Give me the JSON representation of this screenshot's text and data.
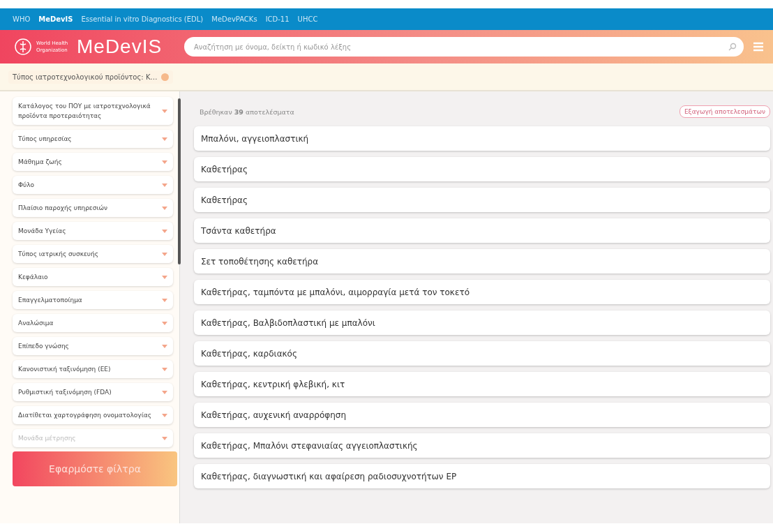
{
  "nav": [
    {
      "label": "WHO",
      "selected": false
    },
    {
      "label": "MeDevIS",
      "selected": true
    },
    {
      "label": "Essential in vitro Diagnostics (EDL)",
      "selected": false
    },
    {
      "label": "MeDevPACKs",
      "selected": false
    },
    {
      "label": "ICD-11",
      "selected": false
    },
    {
      "label": "UHCC",
      "selected": false
    }
  ],
  "logo": {
    "org": "World Health Organization",
    "title": "MeDevIS"
  },
  "search": {
    "placeholder": "Αναζήτηση με όνομα, δείκτη ή κωδικό λέξης"
  },
  "active_filters": [
    {
      "label": "Τύπος ιατροτεχνολογικού προϊόντος: Κ…"
    }
  ],
  "filters": [
    {
      "label": "Κατάλογος του ΠΟΥ με ιατροτεχνολογικά προϊόντα προτεραιότητας",
      "disabled": false
    },
    {
      "label": "Τύπος υπηρεσίας",
      "disabled": false
    },
    {
      "label": "Μάθημα ζωής",
      "disabled": false
    },
    {
      "label": "Φύλο",
      "disabled": false
    },
    {
      "label": "Πλαίσιο παροχής υπηρεσιών",
      "disabled": false
    },
    {
      "label": "Μονάδα Υγείας",
      "disabled": false
    },
    {
      "label": "Τύπος ιατρικής συσκευής",
      "disabled": false
    },
    {
      "label": "Κεφάλαιο",
      "disabled": false
    },
    {
      "label": "Επαγγελματοποίημα",
      "disabled": false
    },
    {
      "label": "Αναλώσιμα",
      "disabled": false
    },
    {
      "label": "Επίπεδο γνώσης",
      "disabled": false
    },
    {
      "label": "Κανονιστική ταξινόμηση (ΕΕ)",
      "disabled": false
    },
    {
      "label": "Ρυθμιστική ταξινόμηση (FDA)",
      "disabled": false
    },
    {
      "label": "Διατίθεται χαρτογράφηση ονοματολογίας",
      "disabled": false
    },
    {
      "label": "Μονάδα μέτρησης",
      "disabled": true
    }
  ],
  "apply_button": "Εφαρμόστε φίλτρα",
  "results_count": "Βρέθηκαν **39** αποτελέσματα",
  "export_button": "Εξαγωγή αποτελεσμάτων",
  "results": [
    "Μπαλόνι, αγγειοπλαστική",
    "Καθετήρας",
    "Καθετήρας",
    "Τσάντα καθετήρα",
    "Σετ τοποθέτησης καθετήρα",
    "Καθετήρας, ταμπόντα με μπαλόνι, αιμορραγία μετά τον τοκετό",
    "Καθετήρας, Βαλβιδοπλαστική με μπαλόνι",
    "Καθετήρας, καρδιακός",
    "Καθετήρας, κεντρική φλεβική, κιτ",
    "Καθετήρας, αυχενική αναρρόφηση",
    "Καθετήρας, Μπαλόνι στεφανιαίας αγγειοπλαστικής",
    "Καθετήρας, διαγνωστική και αφαίρεση ραδιοσυχνοτήτων ΕΡ"
  ]
}
